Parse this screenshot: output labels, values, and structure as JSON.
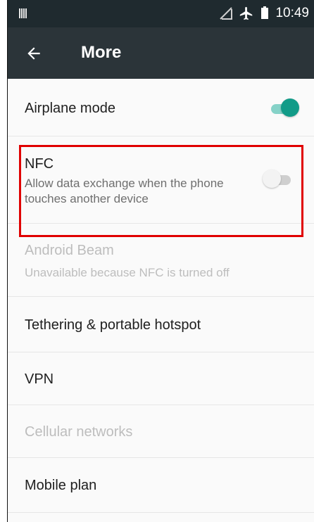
{
  "status_bar": {
    "time": "10:49",
    "icons": [
      "signal-bars-icon",
      "no-sim-icon",
      "airplane-icon",
      "battery-icon"
    ]
  },
  "toolbar": {
    "title": "More",
    "back_icon": "back-arrow-icon"
  },
  "settings": {
    "airplane": {
      "title": "Airplane mode",
      "enabled": true
    },
    "nfc": {
      "title": "NFC",
      "summary": "Allow data exchange when the phone touches another device",
      "enabled": false
    },
    "android_beam": {
      "title": "Android Beam",
      "summary": "Unavailable because NFC is turned off"
    },
    "tethering": {
      "title": "Tethering & portable hotspot"
    },
    "vpn": {
      "title": "VPN"
    },
    "cellular": {
      "title": "Cellular networks"
    },
    "mobile_plan": {
      "title": "Mobile plan"
    }
  },
  "colors": {
    "toolbar": "#2b3439",
    "status_bar": "#1f2a2f",
    "accent": "#129b88",
    "highlight": "#e00000"
  }
}
